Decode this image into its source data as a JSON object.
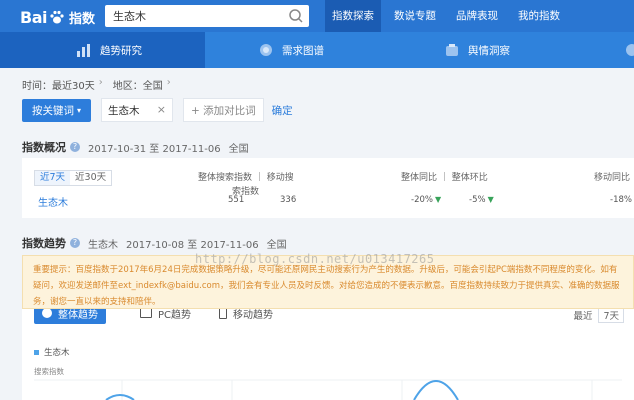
{
  "header": {
    "logo_text": "Bai",
    "logo_text2": "du",
    "logo_sub": "指数",
    "search_value": "生态木",
    "nav": [
      "指数探索",
      "数说专题",
      "品牌表现",
      "我的指数"
    ],
    "active_nav": "指数探索"
  },
  "subnav": {
    "items": [
      "趋势研究",
      "需求图谱",
      "舆情洞察"
    ],
    "active": "趋势研究"
  },
  "filters": {
    "time": "时间：最近30天",
    "region": "地区：全国"
  },
  "controls": {
    "mode_button": "按关键词",
    "keyword": "生态木",
    "add_compare": "+ 添加对比词",
    "confirm": "确定"
  },
  "overview": {
    "title": "指数概况",
    "date_range": "2017-10-31 至 2017-11-06",
    "region": "全国",
    "tabs": [
      "近7天",
      "近30天"
    ],
    "active_tab": "近7天",
    "col_search": "整体搜索指数 ｜ 移动搜",
    "col_search2": "索指数",
    "col_yoy": "整体同比 ｜ 整体环比",
    "col_mobile": "移动同比",
    "row": {
      "keyword": "生态木",
      "overall": "551",
      "mobile": "336",
      "yoy": "-20%",
      "mom": "-5%",
      "mobile_yoy": "-18%"
    }
  },
  "trend": {
    "title": "指数趋势",
    "keyword": "生态木",
    "date_range": "2017-10-08 至 2017-11-06",
    "region": "全国",
    "notice": "重要提示：百度指数于2017年6月24日完成数据策略升级，尽可能还原网民主动搜索行为产生的数据。升级后，可能会引起PC端指数不同程度的变化。如有疑问，欢迎发送邮件至ext_indexfk@baidu.com，我们会有专业人员及时反馈。对给您造成的不便表示歉意。百度指数持续致力于提供真实、准确的数据服务，谢您一直以来的支持和陪伴。",
    "watermark": "http://blog.csdn.net/u013417265",
    "tabs": [
      "整体趋势",
      "PC趋势",
      "移动趋势"
    ],
    "active_tab": "整体趋势",
    "recent_label": "最近",
    "recent_value": "7天",
    "legend": "生态木",
    "ylabel": "搜索指数"
  },
  "colors": {
    "topbar": "#2a76d2",
    "subnav": "#2f82dc",
    "accent": "#2d7ddb",
    "down": "#38a35a",
    "notice_text": "#d98a2e"
  }
}
